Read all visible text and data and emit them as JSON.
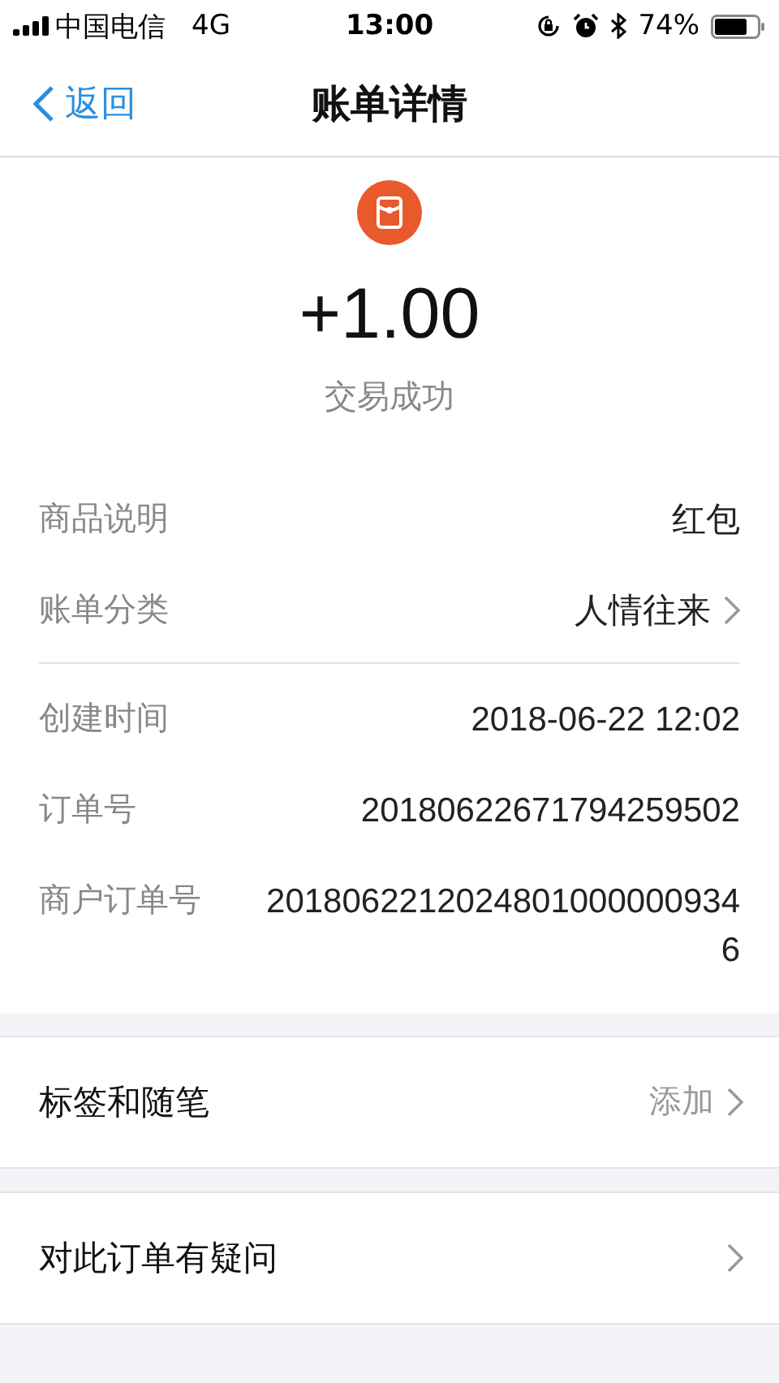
{
  "status_bar": {
    "carrier": "中国电信",
    "network": "4G",
    "time": "13:00",
    "battery": "74%"
  },
  "nav": {
    "back": "返回",
    "title": "账单详情"
  },
  "summary": {
    "amount": "+1.00",
    "status": "交易成功"
  },
  "groups": [
    {
      "rows": [
        {
          "kind": "plain",
          "label": "商品说明",
          "value": "红包"
        },
        {
          "kind": "link",
          "label": "账单分类",
          "value": "人情往来"
        }
      ]
    },
    {
      "rows": [
        {
          "kind": "plain",
          "label": "创建时间",
          "value": "2018-06-22 12:02"
        },
        {
          "kind": "plain",
          "label": "订单号",
          "value": "20180622671794259502"
        },
        {
          "kind": "wrap",
          "label": "商户订单号",
          "value": "20180622120248010000009346"
        }
      ]
    }
  ],
  "actions": [
    {
      "label": "标签和随笔",
      "value": "添加"
    },
    {
      "label": "对此订单有疑问"
    }
  ]
}
